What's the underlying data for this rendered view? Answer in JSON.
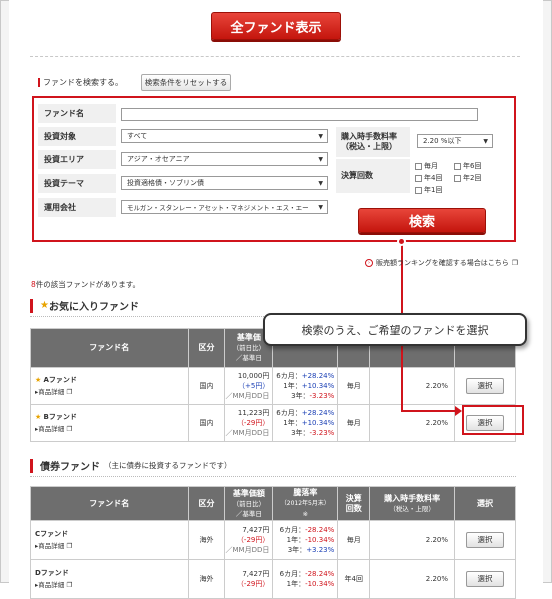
{
  "top_button": "全ファンド表示",
  "search": {
    "heading_prefix": "ファンド",
    "heading_suffix": "を検索する。",
    "reset_button": "検索条件をリセットする",
    "fund_name_label": "ファンド名",
    "target_label": "投資対象",
    "target_value": "すべて",
    "area_label": "投資エリア",
    "area_value": "アジア・オセアニア",
    "theme_label": "投資テーマ",
    "theme_value": "投資適格債・ソブリン債",
    "company_label": "運用会社",
    "company_value": "モルガン・スタンレー・アセット・マネジメント・エス・エー",
    "fee_label_1": "購入時手数料率",
    "fee_label_2": "（税込・上限）",
    "fee_value": "2.20 %以下",
    "settle_label": "決算回数",
    "settle_options": [
      "毎月",
      "年6回",
      "年4回",
      "年2回",
      "年1回"
    ],
    "search_button": "検索"
  },
  "ranking_link": "販売額ランキングを確認する場合はこちら",
  "result_count_num": "8",
  "result_count_text": "件の該当ファンドがあります。",
  "callout_text": "検索のうえ、ご希望のファンドを選択",
  "favorites": {
    "title": "お気に入りファンド",
    "headers": [
      "ファンド名",
      "区分",
      "基準価",
      "（前日比）",
      "／基準日"
    ],
    "rows": [
      {
        "name": "Aファンド",
        "detail": "商品詳細",
        "category": "国内",
        "price": "10,000円",
        "change": "（+5円）",
        "date": "／MM月DD日",
        "r6": "6カ月：",
        "v6": "+28.24%",
        "r1": "1年：",
        "v1": "+10.34%",
        "r3": "3年：",
        "v3": "-3.23%",
        "settle": "毎月",
        "fee": "2.20%",
        "select": "選択"
      },
      {
        "name": "Bファンド",
        "detail": "商品詳細",
        "category": "国内",
        "price": "11,223円",
        "change": "（-29円）",
        "date": "／MM月DD日",
        "r6": "6カ月：",
        "v6": "+28.24%",
        "r1": "1年：",
        "v1": "+10.34%",
        "r3": "3年：",
        "v3": "-3.23%",
        "settle": "毎月",
        "fee": "2.20%",
        "select": "選択"
      }
    ]
  },
  "bond": {
    "title": "債券ファンド",
    "subtitle": "（主に債券に投資するファンドです）",
    "headers": {
      "name": "ファンド名",
      "category": "区分",
      "price": "基準価額",
      "price_sub1": "（前日比）",
      "price_sub2": "／基準日",
      "rate": "騰落率",
      "rate_sub1": "（2012年5月末）",
      "rate_sub2": "※",
      "settle": "決算",
      "settle2": "回数",
      "fee": "購入時手数料率",
      "fee_sub": "（税込・上限）",
      "select": "選択"
    },
    "rows": [
      {
        "name": "Cファンド",
        "detail": "商品詳細",
        "category": "海外",
        "price": "7,427円",
        "change": "（-29円）",
        "date": "／MM月DD日",
        "r6": "6カ月：",
        "v6": "-28.24%",
        "r1": "1年：",
        "v1": "-10.34%",
        "r3": "3年：",
        "v3": "+3.23%",
        "settle": "毎月",
        "fee": "2.20%",
        "select": "選択"
      },
      {
        "name": "Dファンド",
        "detail": "商品詳細",
        "category": "海外",
        "price": "7,427円",
        "change": "（-29円）",
        "date": "",
        "r6": "6カ月：",
        "v6": "-28.24%",
        "r1": "1年：",
        "v1": "-10.34%",
        "r3": "",
        "v3": "",
        "settle": "年4回",
        "fee": "2.20%",
        "select": "選択"
      }
    ]
  }
}
